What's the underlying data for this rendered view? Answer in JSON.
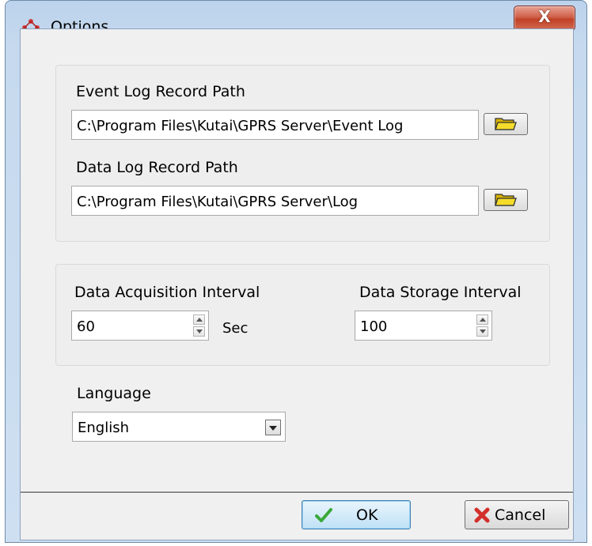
{
  "window": {
    "title": "Options",
    "close_glyph": "X"
  },
  "paths": {
    "event_log_label": "Event Log Record Path",
    "event_log_value": "C:\\Program Files\\Kutai\\GPRS Server\\Event Log",
    "data_log_label": "Data Log Record Path",
    "data_log_value": "C:\\Program Files\\Kutai\\GPRS Server\\Log"
  },
  "intervals": {
    "acquisition_label": "Data Acquisition Interval",
    "acquisition_value": "60",
    "acquisition_unit": "Sec",
    "storage_label": "Data Storage Interval",
    "storage_value": "100"
  },
  "language": {
    "label": "Language",
    "selected": "English"
  },
  "buttons": {
    "ok": "OK",
    "cancel": "Cancel"
  },
  "icons": {
    "app": "options-diamond-icon",
    "browse": "folder-open-icon",
    "ok": "checkmark-icon",
    "cancel": "x-cancel-icon"
  },
  "colors": {
    "ok_check": "#3aa83a",
    "cancel_x": "#d2302b",
    "folder": "#f2d21c",
    "close_button": "#c94a32"
  }
}
